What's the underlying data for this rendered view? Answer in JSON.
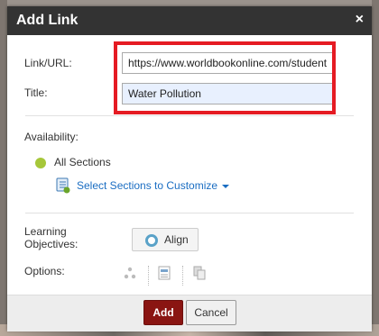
{
  "dialog": {
    "title": "Add Link",
    "close_glyph": "×"
  },
  "form": {
    "link_label": "Link/URL:",
    "link_value": "https://www.worldbookonline.com/student",
    "title_label": "Title:",
    "title_value": "Water Pollution",
    "availability_label": "Availability:",
    "all_sections_label": "All Sections",
    "select_sections_link": "Select Sections to Customize",
    "learning_objectives_label_1": "Learning",
    "learning_objectives_label_2": "Objectives:",
    "align_button": "Align",
    "options_label": "Options:"
  },
  "footer": {
    "add_button": "Add",
    "cancel_button": "Cancel"
  },
  "colors": {
    "title_bar": "#333333",
    "add_button": "#8a1512",
    "highlight_box": "#e51b23",
    "status_dot": "#a6c73a",
    "link": "#1a6dc2"
  },
  "icons": [
    "close-icon",
    "sections-list-icon",
    "chevron-down-icon",
    "align-target-icon",
    "hierarchy-icon",
    "record-icon",
    "copy-icon"
  ]
}
